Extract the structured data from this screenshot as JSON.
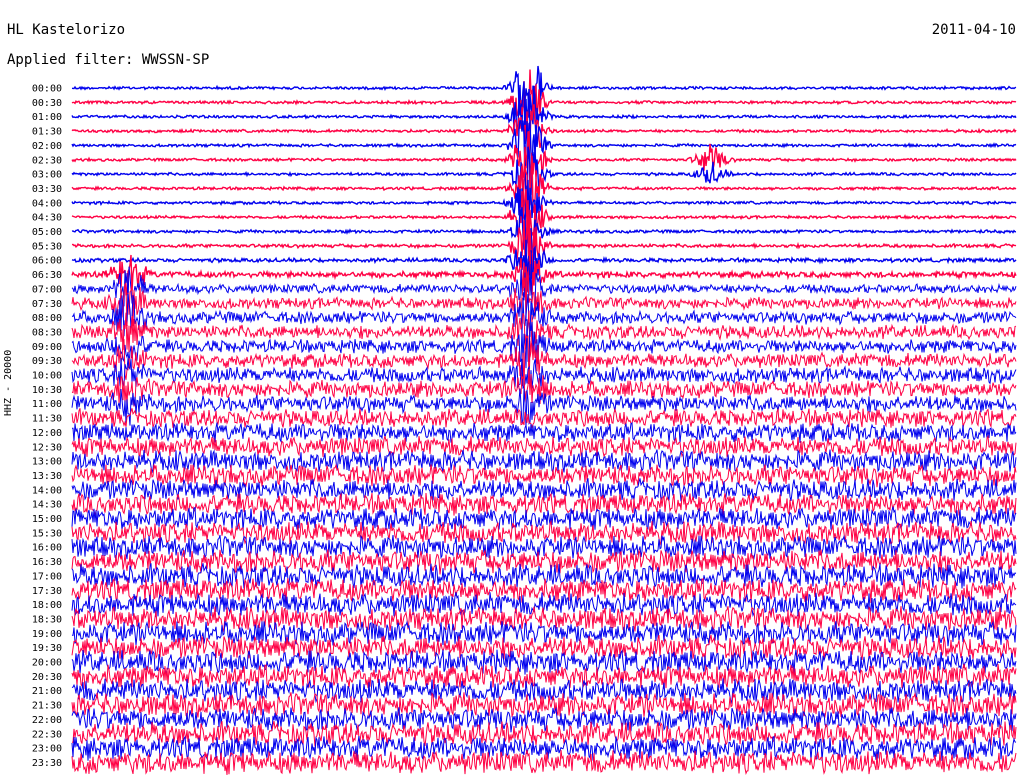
{
  "header": {
    "station": "HL Kastelorizo",
    "date": "2011-04-10",
    "filter_text": "Applied filter: WWSSN-SP",
    "channel_label": "HHZ - 20000"
  },
  "colors": {
    "trace_a": "#0000ee",
    "trace_b": "#ff0044",
    "background": "#ffffff"
  },
  "chart_data": {
    "type": "line",
    "title": "HL Kastelorizo",
    "subtitle": "Applied filter: WWSSN-SP",
    "ylabel": "HHZ - 20000",
    "xlabel": "",
    "row_labels": [
      "00:00",
      "00:30",
      "01:00",
      "01:30",
      "02:00",
      "02:30",
      "03:00",
      "03:30",
      "04:00",
      "04:30",
      "05:00",
      "05:30",
      "06:00",
      "06:30",
      "07:00",
      "07:30",
      "08:00",
      "08:30",
      "09:00",
      "09:30",
      "10:00",
      "10:30",
      "11:00",
      "11:30",
      "12:00",
      "12:30",
      "13:00",
      "13:30",
      "14:00",
      "14:30",
      "15:00",
      "15:30",
      "16:00",
      "16:30",
      "17:00",
      "17:30",
      "18:00",
      "18:30",
      "19:00",
      "19:30",
      "20:00",
      "20:30",
      "21:00",
      "21:30",
      "22:00",
      "22:30",
      "23:00",
      "23:30"
    ],
    "row_colors": [
      "blue",
      "red"
    ],
    "minutes_per_row": 30,
    "noise_level_by_row": [
      0.05,
      0.05,
      0.05,
      0.05,
      0.05,
      0.05,
      0.05,
      0.05,
      0.05,
      0.05,
      0.06,
      0.08,
      0.1,
      0.2,
      0.35,
      0.45,
      0.5,
      0.55,
      0.55,
      0.6,
      0.65,
      0.7,
      0.7,
      0.75,
      0.8,
      0.85,
      0.9,
      0.9,
      0.9,
      0.9,
      0.95,
      0.95,
      0.95,
      1,
      1,
      1,
      1,
      1,
      1,
      1,
      1,
      1,
      1,
      1,
      1,
      1,
      1,
      1
    ],
    "events": [
      {
        "row_start": "00:00",
        "row_end": "11:00",
        "minute": 14.5,
        "amplitude": 1.0
      },
      {
        "row_start": "02:30",
        "row_end": "03:00",
        "minute": 20.3,
        "amplitude": 0.35
      },
      {
        "row_start": "06:30",
        "row_end": "11:00",
        "minute": 1.8,
        "amplitude": 0.6
      }
    ]
  }
}
